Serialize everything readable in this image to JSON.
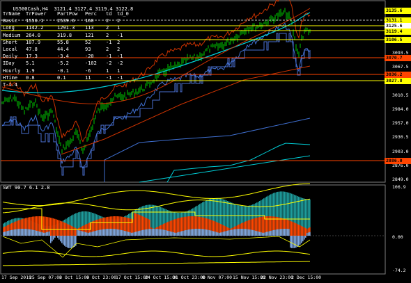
{
  "header": {
    "symbol": "US500Cash,H4",
    "ohlc": "3121.4 3127.4 3119.4 3122.8"
  },
  "tp_table": {
    "columns": [
      "TrName",
      "TrPower",
      "PartPow",
      "Perc",
      "td",
      "td_0"
    ],
    "rows": [
      [
        "Basic",
        "1556.1",
        "2539.6",
        "160",
        "2",
        "2"
      ],
      [
        "Long",
        "1142.2",
        "1291.3",
        "113",
        "2",
        "1"
      ],
      [
        "Medium",
        "264.0",
        "319.8",
        "121",
        "2",
        "-1"
      ],
      [
        "Short",
        "107.9",
        "55.8",
        "52",
        "-1",
        "2"
      ],
      [
        "Local",
        "47.8",
        "44.4",
        "93",
        "2",
        "2"
      ],
      [
        "Daily",
        "17.3",
        "-3.4",
        "-20",
        "-1",
        "-1"
      ],
      [
        "IDay",
        "5.1",
        "-5.2",
        "-102",
        "-2",
        "-2"
      ],
      [
        "Hourly",
        "1.9",
        "-0.1",
        "-6",
        "1",
        "1"
      ],
      [
        "HTime",
        "0.8",
        "0.1",
        "11",
        "-1",
        "-1"
      ]
    ],
    "extra_label": "T-1.4"
  },
  "price_axis": {
    "ticks": [
      "3172.5",
      "3146.5",
      "3119.4",
      "3093.5",
      "3067.5",
      "3040.5",
      "3010.5",
      "2984.0",
      "2957.0",
      "2930.5",
      "2903.0",
      "2876.0",
      "2849.0"
    ],
    "tags": [
      {
        "text": "3135.6",
        "color": "#ffff00"
      },
      {
        "text": "3131.1",
        "color": "#ffff00"
      },
      {
        "text": "3125.6",
        "color": "#ffffff"
      },
      {
        "text": "3119.4",
        "color": "#ffff00"
      },
      {
        "text": "3106.5",
        "color": "#ffff00"
      },
      {
        "text": "3070.7",
        "color": "#ff4500"
      },
      {
        "text": "3036.2",
        "color": "#ff4500"
      },
      {
        "text": "3027.8",
        "color": "#ffff00"
      },
      {
        "text": "2886.0",
        "color": "#ff4500"
      }
    ]
  },
  "indicator": {
    "title": "SWT 90.7 6.1 2.8",
    "ticks": [
      "106.9",
      "0.00",
      "-74.2"
    ]
  },
  "time_axis": {
    "labels": [
      "17 Sep 2019",
      "25 Sep 07:00",
      "2 Oct 15:00",
      "9 Oct 23:00",
      "17 Oct 15:00",
      "24 Oct 15:00",
      "31 Oct 23:00",
      "8 Nov 07:00",
      "15 Nov 15:00",
      "22 Nov 23:00",
      "2 Dec 15:00"
    ]
  },
  "colors": {
    "background": "#000000",
    "candles": "#00cc00",
    "ma_upper": "#cc3300",
    "ma_mid": "#3f6fd0",
    "cyan_line": "#00cfd8",
    "yellow_levels": "#ffff00",
    "histogram_up": "#1f9e9e",
    "histogram_orange": "#ff4500",
    "histogram_blue": "#7fa7e0"
  }
}
